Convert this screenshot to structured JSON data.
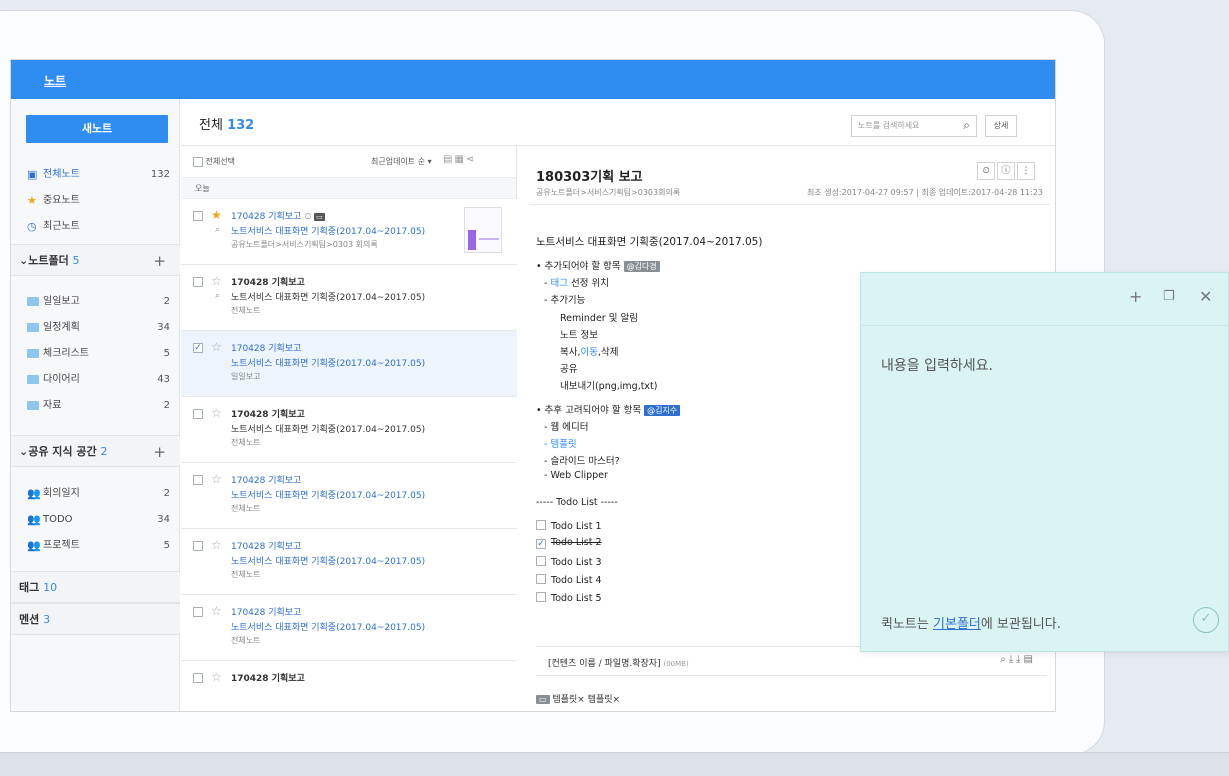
{
  "app": {
    "title": "노트"
  },
  "sidebar": {
    "new_note": "새노트",
    "items": [
      {
        "label": "전체노트",
        "count": "132"
      },
      {
        "label": "중요노트",
        "count": ""
      },
      {
        "label": "최근노트",
        "count": ""
      }
    ],
    "folders_section": {
      "label": "노트폴더",
      "count": "5"
    },
    "folders": [
      {
        "label": "일일보고",
        "count": "2"
      },
      {
        "label": "일정계획",
        "count": "34"
      },
      {
        "label": "체크리스트",
        "count": "5"
      },
      {
        "label": "다이어리",
        "count": "43"
      },
      {
        "label": "자료",
        "count": "2"
      }
    ],
    "shared_section": {
      "label": "공유 지식 공간",
      "count": "2"
    },
    "shared": [
      {
        "label": "회의일지",
        "count": "2"
      },
      {
        "label": "TODO",
        "count": "34"
      },
      {
        "label": "프로젝트",
        "count": "5"
      }
    ],
    "tags_section": {
      "label": "태그",
      "count": "10"
    },
    "mention_section": {
      "label": "멘션",
      "count": "3"
    }
  },
  "header": {
    "label": "전체",
    "count": "132",
    "search_placeholder": "노트를 검색하세요",
    "detail_button": "상세"
  },
  "list": {
    "select_all": "전체선택",
    "sort": "최근업데이트 순 ▾",
    "group_today": "오늘",
    "notes": [
      {
        "title": "170428 기획보고",
        "desc": "노트서비스 대표화면 기획중(2017.04~2017.05)",
        "folder": "공유노트폴더>서비스기획팀>0303 회의록",
        "starred": true,
        "selected": false
      },
      {
        "title": "170428 기획보고",
        "desc": "노트서비스 대표화면 기획중(2017.04~2017.05)",
        "folder": "전체노트",
        "starred": false,
        "selected": false
      },
      {
        "title": "170428 기획보고",
        "desc": "노트서비스 대표화면 기획중(2017.04~2017.05)",
        "folder": "일일보고",
        "starred": false,
        "selected": true
      },
      {
        "title": "170428 기획보고",
        "desc": "노트서비스 대표화면 기획중(2017.04~2017.05)",
        "folder": "전체노트",
        "starred": false,
        "selected": false
      },
      {
        "title": "170428 기획보고",
        "desc": "노트서비스 대표화면 기획중(2017.04~2017.05)",
        "folder": "전체노트",
        "starred": false,
        "selected": false
      },
      {
        "title": "170428 기획보고",
        "desc": "노트서비스 대표화면 기획중(2017.04~2017.05)",
        "folder": "전체노트",
        "starred": false,
        "selected": false
      },
      {
        "title": "170428 기획보고",
        "desc": "노트서비스 대표화면 기획중(2017.04~2017.05)",
        "folder": "전체노트",
        "starred": false,
        "selected": false
      },
      {
        "title": "170428 기획보고",
        "desc": "",
        "folder": "",
        "starred": false,
        "selected": false
      }
    ]
  },
  "content": {
    "title": "180303기획 보고",
    "path": "공유노트폴더>서비스기획팀>0303회의록",
    "dates": "최초 생성:2017-04-27 09:57 | 최종 업데이트:2017-04-28 11:23",
    "heading": "노트서비스 대표화면 기획중(2017.04~2017.05)",
    "section1": "• 추가되어야 할 항목",
    "mention1": "@김다경",
    "tag_word": "태그",
    "tag_rest": " 선정 위치",
    "add_func": "- 추가기능",
    "sub1": "Reminder 및 알림",
    "sub2": "노트 정보",
    "copy": "복사,",
    "move": "이동",
    "del": ",삭제",
    "share": "공유",
    "export": "내보내기(png,img,txt)",
    "section2": "• 추후 고려되어야 할 항목",
    "mention2": "@김지수",
    "web_editor": "- 웹 에디터",
    "template": "- 템플릿",
    "slide_master": "- 슬라이드 마스터?",
    "web_clipper": "- Web Clipper",
    "todo_header": "----- Todo List -----",
    "todos": [
      {
        "label": "Todo List 1",
        "done": false
      },
      {
        "label": "Todo List 2",
        "done": true
      },
      {
        "label": "Todo List 3",
        "done": false
      },
      {
        "label": "Todo List 4",
        "done": false
      },
      {
        "label": "Todo List 5",
        "done": false
      }
    ],
    "attachment": "[컨텐츠 이름 / 파일명.확장자]",
    "attachment_size": "(00MB)",
    "tag1": "템플릿×",
    "tag2": "템플릿×"
  },
  "quicknote": {
    "placeholder": "내용을 입력하세요.",
    "footer_prefix": "퀵노트는 ",
    "footer_link": "기본폴더",
    "footer_suffix": "에 보관됩니다."
  }
}
